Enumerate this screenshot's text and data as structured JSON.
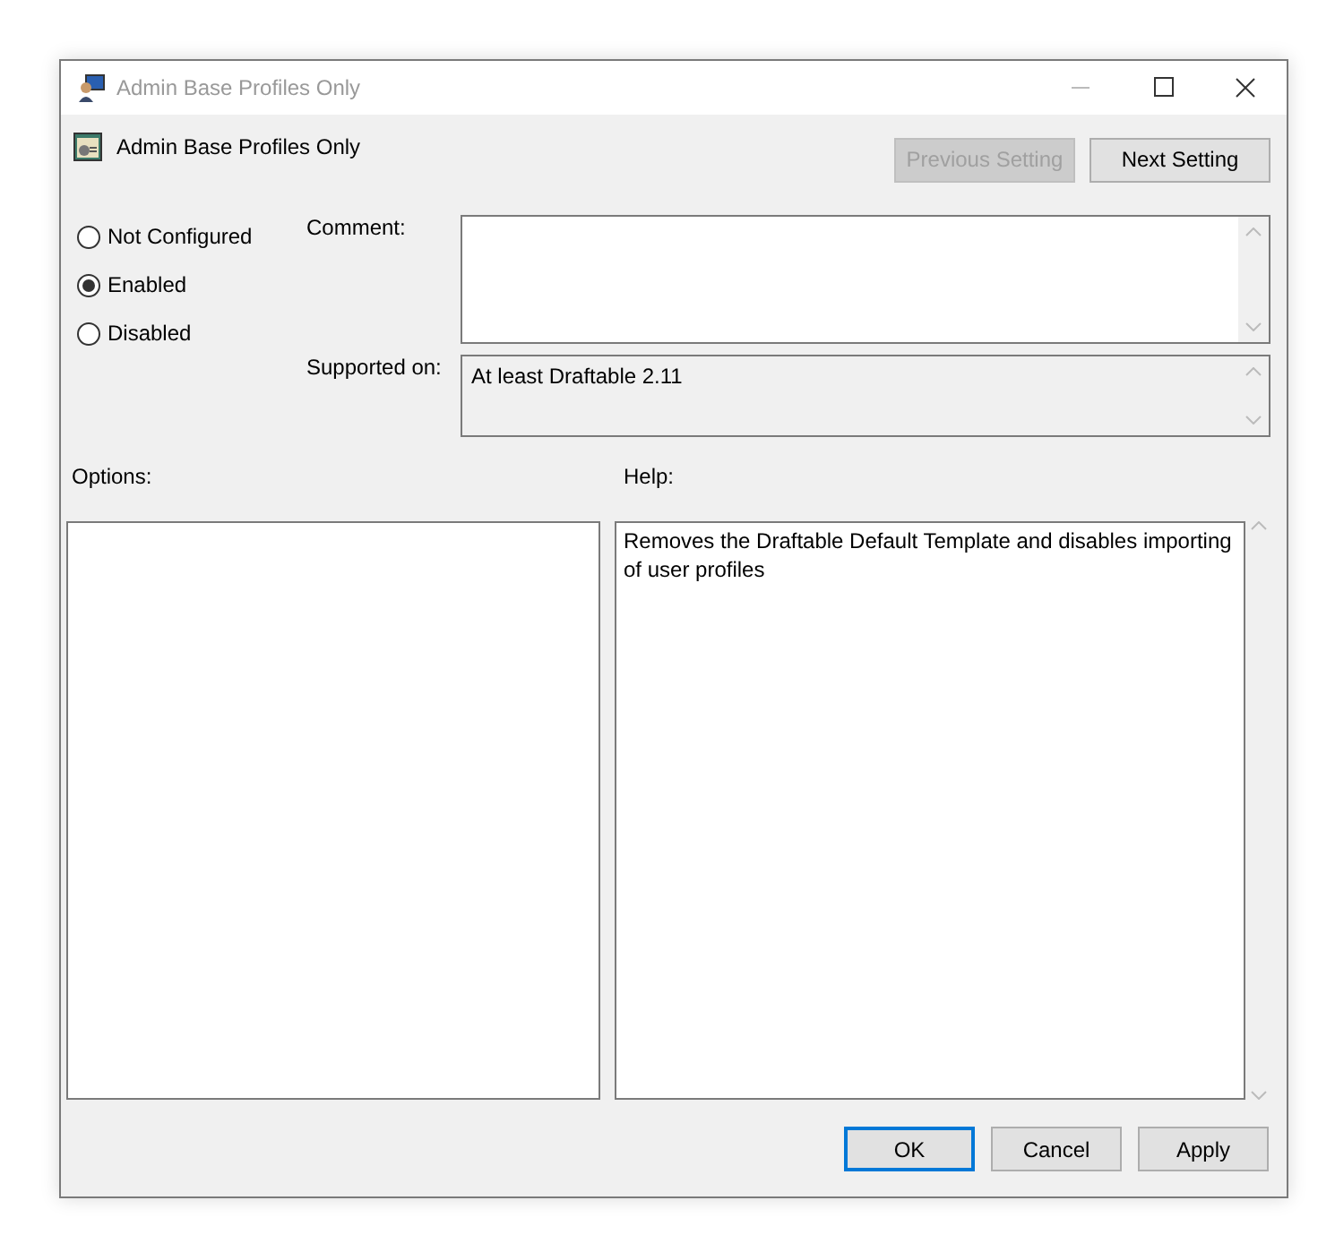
{
  "window": {
    "title": "Admin Base Profiles Only"
  },
  "header": {
    "title": "Admin Base Profiles Only"
  },
  "nav_buttons": [
    {
      "label": "Previous Setting",
      "disabled": true
    },
    {
      "label": "Next Setting",
      "disabled": false
    }
  ],
  "radios": [
    {
      "label": "Not Configured",
      "selected": false
    },
    {
      "label": "Enabled",
      "selected": true
    },
    {
      "label": "Disabled",
      "selected": false
    }
  ],
  "comment": {
    "label": "Comment:"
  },
  "supported_on": {
    "label": "Supported on:",
    "value": "At least Draftable 2.11"
  },
  "options": {
    "label": "Options:"
  },
  "help": {
    "label": "Help:",
    "text": "Removes the Draftable Default Template and disables importing of user profiles"
  },
  "buttons": [
    {
      "label": "OK",
      "default": true
    },
    {
      "label": "Cancel",
      "default": false
    },
    {
      "label": "Apply",
      "default": false
    }
  ]
}
